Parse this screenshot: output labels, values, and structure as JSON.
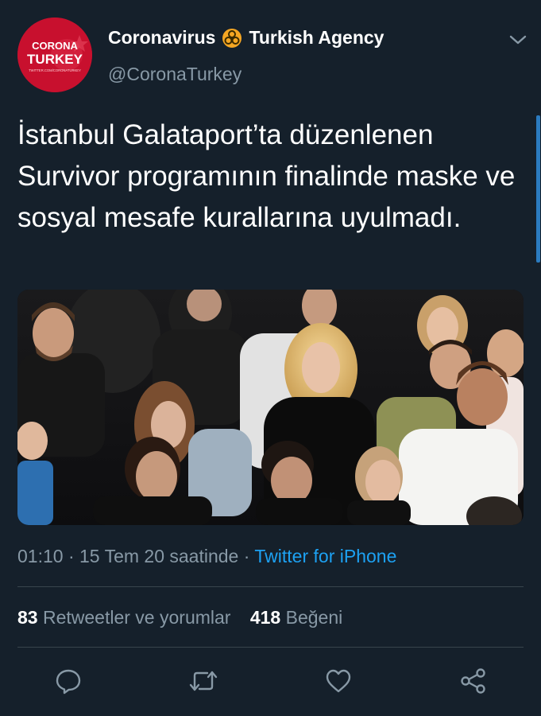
{
  "tweet": {
    "display_name_part1": "Coronavirus",
    "display_name_part2": "Turkish Agency",
    "name_icon": "biohazard-icon",
    "handle": "@CoronaTurkey",
    "avatar": {
      "line1": "CORONA",
      "line2": "TURKEY",
      "line3": "TWITTER.COM/CORONATURKEY",
      "color": "#c8102e"
    },
    "text": "İstanbul Galataport’ta düzenlenen Survivor programının finalinde maske ve sosyal mesafe kurallarına uyulmadı.",
    "time": "01:10",
    "date": "15 Tem 20 saatinde",
    "separator": "·",
    "source": "Twitter for iPhone",
    "retweet_count": "83",
    "retweet_label": "Retweetler ve yorumlar",
    "like_count": "418",
    "like_label": "Beğeni"
  },
  "actions": [
    {
      "name": "reply-icon"
    },
    {
      "name": "retweet-icon"
    },
    {
      "name": "like-icon"
    },
    {
      "name": "share-icon"
    }
  ],
  "colors": {
    "background": "#15202b",
    "secondary_text": "#8899a6",
    "link": "#1da1f2",
    "divider": "#38444d"
  }
}
